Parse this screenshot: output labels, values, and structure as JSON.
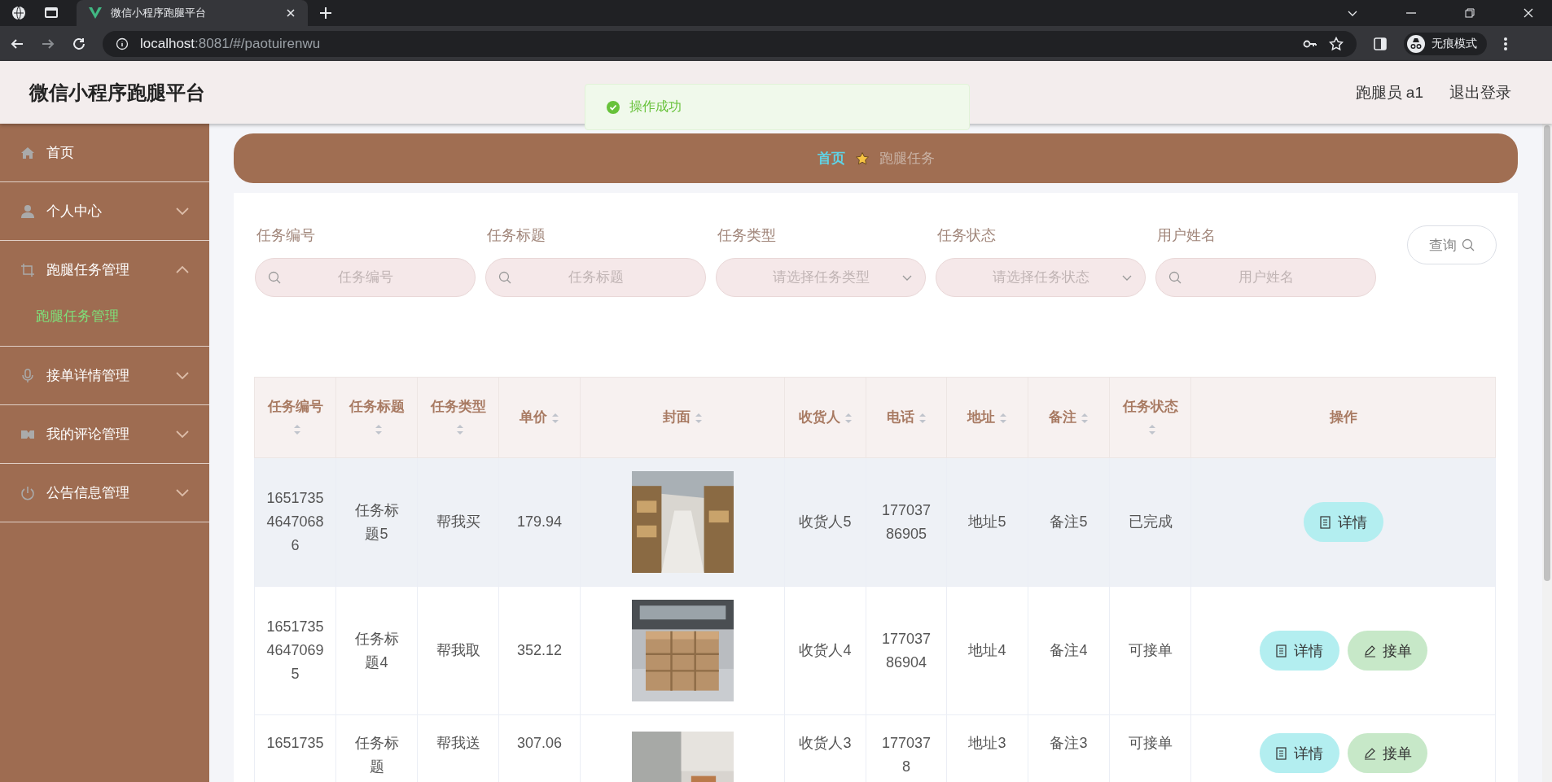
{
  "browser": {
    "tab_title": "微信小程序跑腿平台",
    "url_host": "localhost",
    "url_rest": ":8081/#/paotuirenwu",
    "incognito_label": "无痕模式"
  },
  "header": {
    "title": "微信小程序跑腿平台",
    "user": "跑腿员 a1",
    "logout": "退出登录"
  },
  "toast": {
    "message": "操作成功"
  },
  "sidebar": {
    "items": [
      {
        "label": "首页",
        "kind": "link",
        "expanded": false
      },
      {
        "label": "个人中心",
        "kind": "submenu",
        "expanded": false
      },
      {
        "label": "跑腿任务管理",
        "kind": "submenu",
        "expanded": true,
        "children": [
          {
            "label": "跑腿任务管理",
            "selected": true
          }
        ]
      },
      {
        "label": "接单详情管理",
        "kind": "submenu",
        "expanded": false
      },
      {
        "label": "我的评论管理",
        "kind": "submenu",
        "expanded": false
      },
      {
        "label": "公告信息管理",
        "kind": "submenu",
        "expanded": false
      }
    ]
  },
  "breadcrumb": [
    "首页",
    "跑腿任务"
  ],
  "filters": [
    {
      "label": "任务编号",
      "kind": "text",
      "placeholder": "任务编号"
    },
    {
      "label": "任务标题",
      "kind": "text",
      "placeholder": "任务标题"
    },
    {
      "label": "任务类型",
      "kind": "select",
      "placeholder": "请选择任务类型"
    },
    {
      "label": "任务状态",
      "kind": "select",
      "placeholder": "请选择任务状态"
    },
    {
      "label": "用户姓名",
      "kind": "text",
      "placeholder": "用户姓名"
    }
  ],
  "query_button": "查询",
  "table": {
    "columns": [
      {
        "label": "任务编号",
        "sortable": true
      },
      {
        "label": "任务标题",
        "sortable": true
      },
      {
        "label": "任务类型",
        "sortable": true
      },
      {
        "label": "单价",
        "sortable": true
      },
      {
        "label": "封面",
        "sortable": true
      },
      {
        "label": "收货人",
        "sortable": true
      },
      {
        "label": "电话",
        "sortable": true
      },
      {
        "label": "地址",
        "sortable": true
      },
      {
        "label": "备注",
        "sortable": true
      },
      {
        "label": "任务状态",
        "sortable": true
      },
      {
        "label": "操作",
        "sortable": false
      }
    ],
    "rows": [
      {
        "hovered": true,
        "cells": [
          "165173546470686",
          "任务标题5",
          "帮我买",
          "179.94",
          {
            "kind": "picture"
          },
          "收货人5",
          "17703786905",
          "地址5",
          "备注5",
          "已完成"
        ],
        "actions": [
          {
            "kind": "detail",
            "label": "详情"
          }
        ]
      },
      {
        "hovered": false,
        "cells": [
          "165173546470695",
          "任务标题4",
          "帮我取",
          "352.12",
          {
            "kind": "picture"
          },
          "收货人4",
          "17703786904",
          "地址4",
          "备注4",
          "可接单"
        ],
        "actions": [
          {
            "kind": "detail",
            "label": "详情"
          },
          {
            "kind": "accept",
            "label": "接单"
          }
        ]
      },
      {
        "hovered": false,
        "cells": [
          "1651735",
          "任务标题",
          "帮我送",
          "307.06",
          {
            "kind": "picture"
          },
          "收货人3",
          "1770378",
          "地址3",
          "备注3",
          "可接单"
        ],
        "actions": [
          {
            "kind": "detail",
            "label": "详情"
          },
          {
            "kind": "accept",
            "label": "接单"
          }
        ]
      }
    ]
  }
}
